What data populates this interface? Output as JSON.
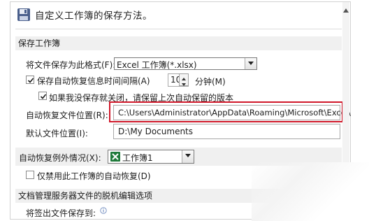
{
  "header": {
    "icon": "save-disk-icon",
    "title": "自定义工作簿的保存方法。"
  },
  "save_section": {
    "heading": "保存工作簿",
    "format_label": "将文件保存为此格式(F):",
    "format_value": "Excel 工作簿(*.xlsx)",
    "autorecover_label": "保存自动恢复信息时间间隔(A)",
    "autorecover_checked": true,
    "interval_value": "10",
    "interval_unit": "分钟(M)",
    "keep_last_label": "如果我没保存就关闭，请保留上次自动保留的版本",
    "keep_last_checked": true,
    "autorecover_location_label": "自动恢复文件位置(R):",
    "autorecover_location_value": "C:\\Users\\Administrator\\AppData\\Roaming\\Microsoft\\Excel\\",
    "default_location_label": "默认文件位置(I):",
    "default_location_value": "D:\\My Documents",
    "highlight_color": "#d0182a"
  },
  "exceptions_section": {
    "label": "自动恢复例外情况(X):",
    "workbook_icon": "excel-workbook-icon",
    "workbook_value": "工作簿1",
    "disable_label": "仅禁用此工作簿的自动恢复(D)",
    "disable_checked": false
  },
  "offline_section": {
    "heading": "文档管理服务器文件的脱机编辑选项",
    "checkout_label": "将签出文件保存到:",
    "info_icon": "info-icon"
  },
  "scrollbar": {
    "up_icon": "scroll-up-icon",
    "down_icon": "scroll-down-icon"
  }
}
